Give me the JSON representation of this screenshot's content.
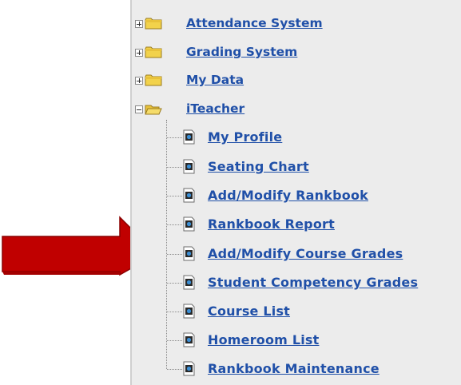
{
  "tree": {
    "top_items": [
      {
        "label": "Attendance System",
        "state": "collapsed"
      },
      {
        "label": "Grading System",
        "state": "collapsed"
      },
      {
        "label": "My Data",
        "state": "collapsed"
      },
      {
        "label": "iTeacher",
        "state": "expanded"
      }
    ],
    "children": [
      {
        "label": "My Profile"
      },
      {
        "label": "Seating Chart"
      },
      {
        "label": "Add/Modify Rankbook"
      },
      {
        "label": "Rankbook Report"
      },
      {
        "label": "Add/Modify Course Grades",
        "highlighted": true
      },
      {
        "label": "Student Competency Grades"
      },
      {
        "label": "Course List"
      },
      {
        "label": "Homeroom List"
      },
      {
        "label": "Rankbook Maintenance"
      }
    ]
  },
  "colors": {
    "link": "#2050a8",
    "arrow": "#c00000",
    "folder": "#f2d24b",
    "panel_bg": "#ececec"
  },
  "icons": {
    "collapsed": "plus-expander-icon",
    "expanded": "minus-expander-icon",
    "folder_closed": "folder-icon",
    "folder_open": "folder-open-icon",
    "page": "document-page-icon"
  }
}
